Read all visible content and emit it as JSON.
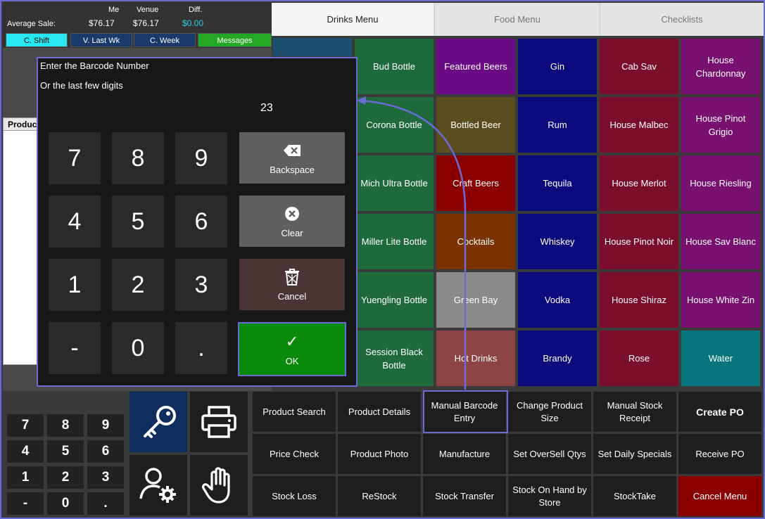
{
  "stats": {
    "avg_label": "Average Sale:",
    "col_me": "Me",
    "col_venue": "Venue",
    "col_diff": "Diff.",
    "val_me": "$76.17",
    "val_venue": "$76.17",
    "val_diff": "$0.00",
    "buttons": [
      "C. Shift",
      "V. Last Wk",
      "C. Week",
      "Messages"
    ]
  },
  "product_panel": {
    "header": "Produc"
  },
  "tabs": [
    "Drinks Menu",
    "Food Menu",
    "Checklists"
  ],
  "menu": {
    "col2": [
      "Bud Bottle",
      "Corona Bottle",
      "Mich Ultra Bottle",
      "Miller Lite Bottle",
      "Yuengling Bottle",
      "Session Black Bottle"
    ],
    "col3": [
      "Featured Beers",
      "Bottled Beer",
      "Craft Beers",
      "Cocktails",
      "Green Bay",
      "Hot Drinks"
    ],
    "col4": [
      "Gin",
      "Rum",
      "Tequila",
      "Whiskey",
      "Vodka",
      "Brandy"
    ],
    "col5": [
      "Cab Sav",
      "House Malbec",
      "House Merlot",
      "House Pinot Noir",
      "House Shiraz",
      "Rose"
    ],
    "col6": [
      "House Chardonnay",
      "House Pinot Grigio",
      "House Riesling",
      "House Sav Blanc",
      "House White Zin",
      "Water"
    ]
  },
  "colors": {
    "green": "#1e6a3c",
    "purple": "#6a0a84",
    "navy": "#0a0a7c",
    "maroon": "#7a0e2a",
    "magenta": "#781070",
    "olive": "#5a4e1e",
    "red": "#8a0000",
    "brown": "#7a3200",
    "gray": "#8a8a8a",
    "rose": "#8c4444",
    "teal": "#08747c",
    "ok_green": "#0a8a0a",
    "accent": "#6b6bd6"
  },
  "small_keypad": [
    "7",
    "8",
    "9",
    "4",
    "5",
    "6",
    "1",
    "2",
    "3",
    "-",
    "0",
    "."
  ],
  "icon_buttons": [
    "key-icon",
    "printer-icon",
    "user-settings-icon",
    "hand-icon"
  ],
  "actions": [
    [
      "Product Search",
      "Product Details",
      "Manual Barcode Entry",
      "Change Product Size",
      "Manual Stock Receipt",
      "Create PO"
    ],
    [
      "Price Check",
      "Product Photo",
      "Manufacture",
      "Set OverSell Qtys",
      "Set Daily Specials",
      "Receive PO"
    ],
    [
      "Stock Loss",
      "ReStock",
      "Stock Transfer",
      "Stock On Hand by Store",
      "StockTake",
      "Cancel Menu"
    ]
  ],
  "dialog": {
    "prompt1": "Enter the Barcode Number",
    "prompt2": "Or the last few digits",
    "entry": "23",
    "keys": [
      "7",
      "8",
      "9",
      "4",
      "5",
      "6",
      "1",
      "2",
      "3",
      "-",
      "0",
      "."
    ],
    "backspace": "Backspace",
    "clear": "Clear",
    "cancel": "Cancel",
    "ok": "OK"
  }
}
